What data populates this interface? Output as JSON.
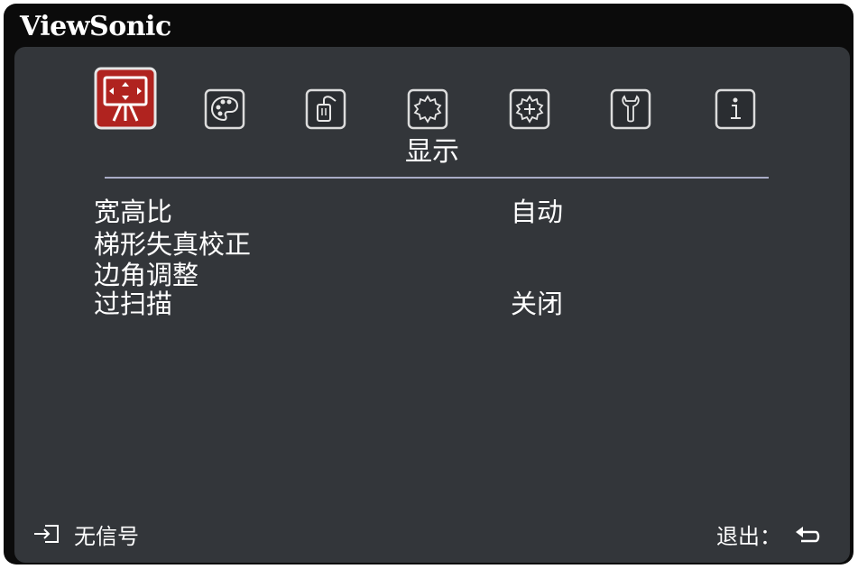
{
  "brand": "ViewSonic",
  "colors": {
    "frame": "#0b0b0b",
    "panel": "#33363a",
    "active_tab": "#b0231f",
    "text": "#ffffff",
    "divider": "#a9acc6"
  },
  "tabs": [
    {
      "icon": "display-icon",
      "active": true
    },
    {
      "icon": "palette-icon",
      "active": false
    },
    {
      "icon": "power-management-icon",
      "active": false
    },
    {
      "icon": "basic-settings-icon",
      "active": false
    },
    {
      "icon": "advanced-settings-icon",
      "active": false
    },
    {
      "icon": "wrench-icon",
      "active": false
    },
    {
      "icon": "info-icon",
      "active": false
    }
  ],
  "menu": {
    "title": "显示",
    "items": [
      {
        "label": "宽高比",
        "value": "自动"
      },
      {
        "label": "梯形失真校正",
        "value": ""
      },
      {
        "label": "边角调整",
        "value": ""
      },
      {
        "label": "过扫描",
        "value": "关闭"
      }
    ]
  },
  "footer": {
    "source_status": "无信号",
    "exit_label": "退出："
  }
}
